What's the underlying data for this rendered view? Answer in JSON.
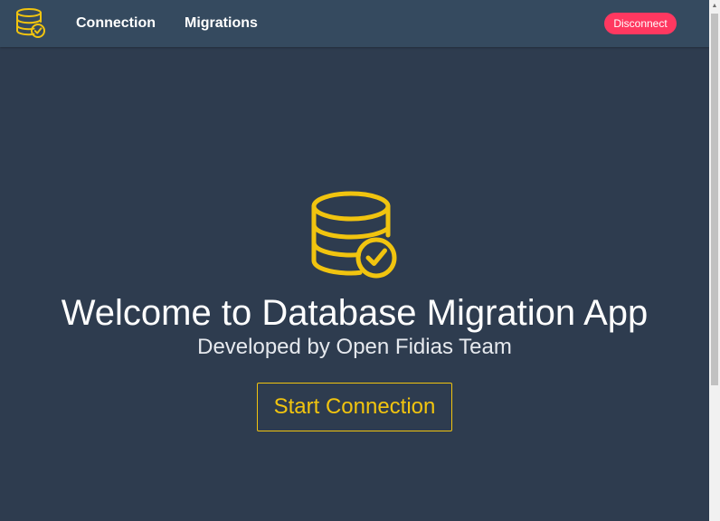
{
  "navbar": {
    "logo_icon": "database-check-icon",
    "links": [
      {
        "label": "Connection"
      },
      {
        "label": "Migrations"
      }
    ],
    "disconnect_label": "Disconnect"
  },
  "hero": {
    "icon": "database-check-icon",
    "title": "Welcome to Database Migration App",
    "subtitle": "Developed by Open Fidias Team",
    "start_button_label": "Start Connection"
  },
  "colors": {
    "background": "#2e3c4f",
    "navbar": "#354a5f",
    "accent": "#f1c40f",
    "danger": "#ff3860",
    "text": "#ffffff"
  }
}
